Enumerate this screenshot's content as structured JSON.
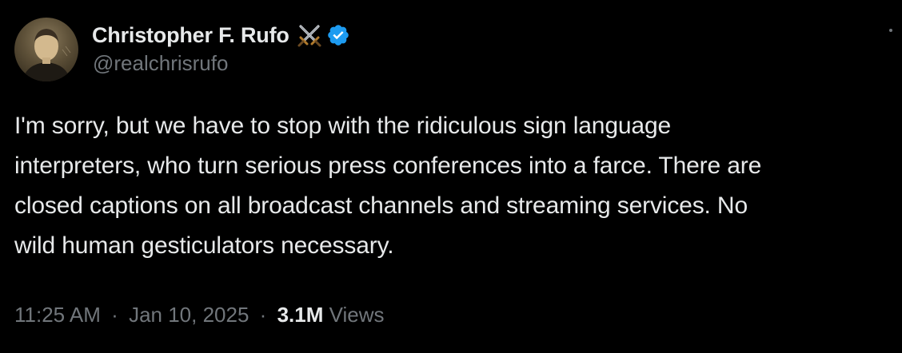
{
  "author": {
    "display_name": "Christopher F. Rufo",
    "handle": "@realchrisrufo",
    "name_emoji": "crossed-swords-icon",
    "verified": true,
    "verified_color": "#1d9bf0"
  },
  "tweet": {
    "text": "I'm sorry, but we have to stop with the ridiculous sign language\ninterpreters, who turn serious press conferences into a farce. There are\nclosed captions on all broadcast channels and streaming services. No\nwild human gesticulators necessary."
  },
  "meta": {
    "time": "11:25 AM",
    "separator": "·",
    "date": "Jan 10, 2025",
    "views_count": "3.1M",
    "views_label": "Views"
  },
  "colors": {
    "background": "#000000",
    "primary_text": "#e7e9ea",
    "secondary_text": "#71767b"
  }
}
